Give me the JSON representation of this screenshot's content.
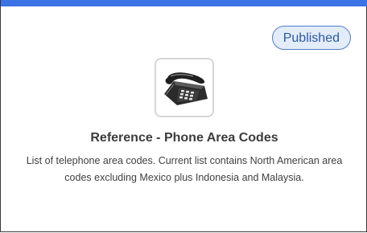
{
  "card": {
    "status": "Published",
    "icon": "telephone-icon",
    "title": "Reference - Phone Area Codes",
    "description": "List of telephone area codes. Current list contains North American area codes excluding Mexico plus Indonesia and Malaysia."
  },
  "colors": {
    "accent": "#3b73e6",
    "badge_border": "#4f7fc4",
    "badge_bg": "#e3ecf9",
    "badge_text": "#2a5aa3"
  }
}
